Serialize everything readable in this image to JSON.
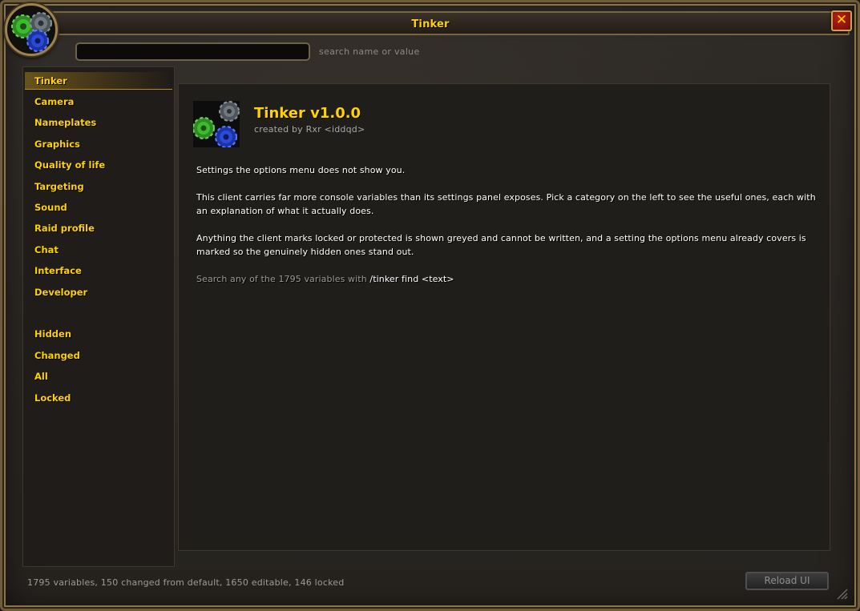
{
  "window": {
    "title": "Tinker",
    "close_label": "✕"
  },
  "search": {
    "value": "",
    "hint": "search name or value"
  },
  "sidebar": {
    "items": [
      {
        "label": "Tinker",
        "active": true
      },
      {
        "label": "Camera"
      },
      {
        "label": "Nameplates"
      },
      {
        "label": "Graphics"
      },
      {
        "label": "Quality of life"
      },
      {
        "label": "Targeting"
      },
      {
        "label": "Sound"
      },
      {
        "label": "Raid profile"
      },
      {
        "label": "Chat"
      },
      {
        "label": "Interface"
      },
      {
        "label": "Developer"
      }
    ],
    "filters": [
      {
        "label": "Hidden"
      },
      {
        "label": "Changed"
      },
      {
        "label": "All"
      },
      {
        "label": "Locked"
      }
    ]
  },
  "main": {
    "addon_icon": "gears-icon",
    "title": "Tinker v1.0.0",
    "author": "created by Rxr <iddqd>",
    "paragraphs": [
      "Settings the options menu does not show you.",
      "This client carries far more console variables than its settings panel exposes. Pick a category on the left to see the useful ones, each with an explanation of what it actually does.",
      "Anything the client marks locked or protected is shown greyed and cannot be written, and a setting the options menu already covers is marked so the genuinely hidden ones stand out."
    ],
    "hint_prefix": "Search any of the 1795 variables with ",
    "hint_command": "/tinker find <text>"
  },
  "footer": {
    "status": "1795 variables, 150 changed from default, 1650 editable, 146 locked",
    "reload_label": "Reload UI"
  },
  "colors": {
    "accent_gold": "#ffd100",
    "close_red": "#b01c15",
    "gear_green": "#3dbb2e",
    "gear_blue": "#2a4bd8",
    "gear_gray": "#6f7a80"
  }
}
